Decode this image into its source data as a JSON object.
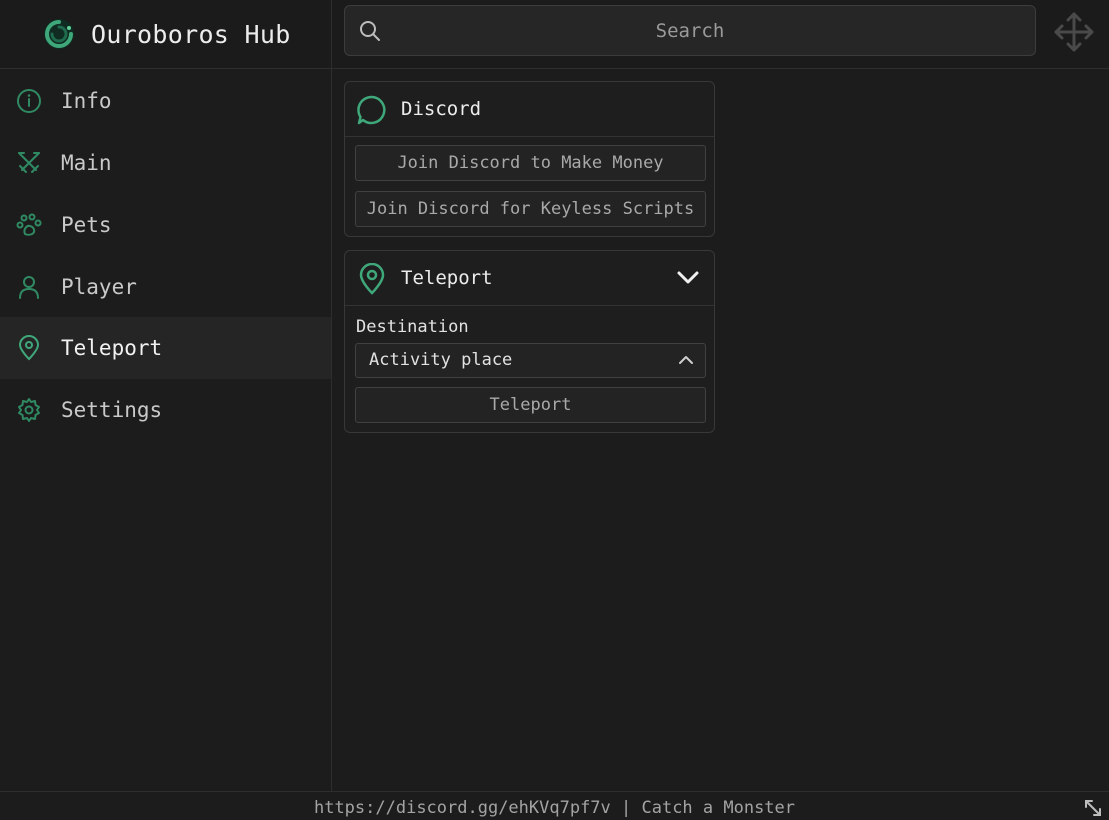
{
  "app": {
    "title": "Ouroboros Hub"
  },
  "search": {
    "placeholder": "Search"
  },
  "sidebar": {
    "items": [
      {
        "label": "Info",
        "icon": "info-icon"
      },
      {
        "label": "Main",
        "icon": "swords-icon"
      },
      {
        "label": "Pets",
        "icon": "paw-icon"
      },
      {
        "label": "Player",
        "icon": "user-icon"
      },
      {
        "label": "Teleport",
        "icon": "map-pin-icon",
        "active": true
      },
      {
        "label": "Settings",
        "icon": "gear-icon"
      }
    ]
  },
  "sections": {
    "discord": {
      "title": "Discord",
      "buttons": [
        "Join Discord to Make Money",
        "Join Discord for Keyless Scripts"
      ]
    },
    "teleport": {
      "title": "Teleport",
      "destination_label": "Destination",
      "destination_value": "Activity place",
      "button": "Teleport"
    }
  },
  "footer": {
    "text": "https://discord.gg/ehKVq7pf7v | Catch a Monster"
  },
  "colors": {
    "accent": "#3fa87a",
    "background": "#1c1c1c",
    "panel": "#1e1e1e",
    "border": "#383838",
    "text": "#e6e6e6"
  }
}
